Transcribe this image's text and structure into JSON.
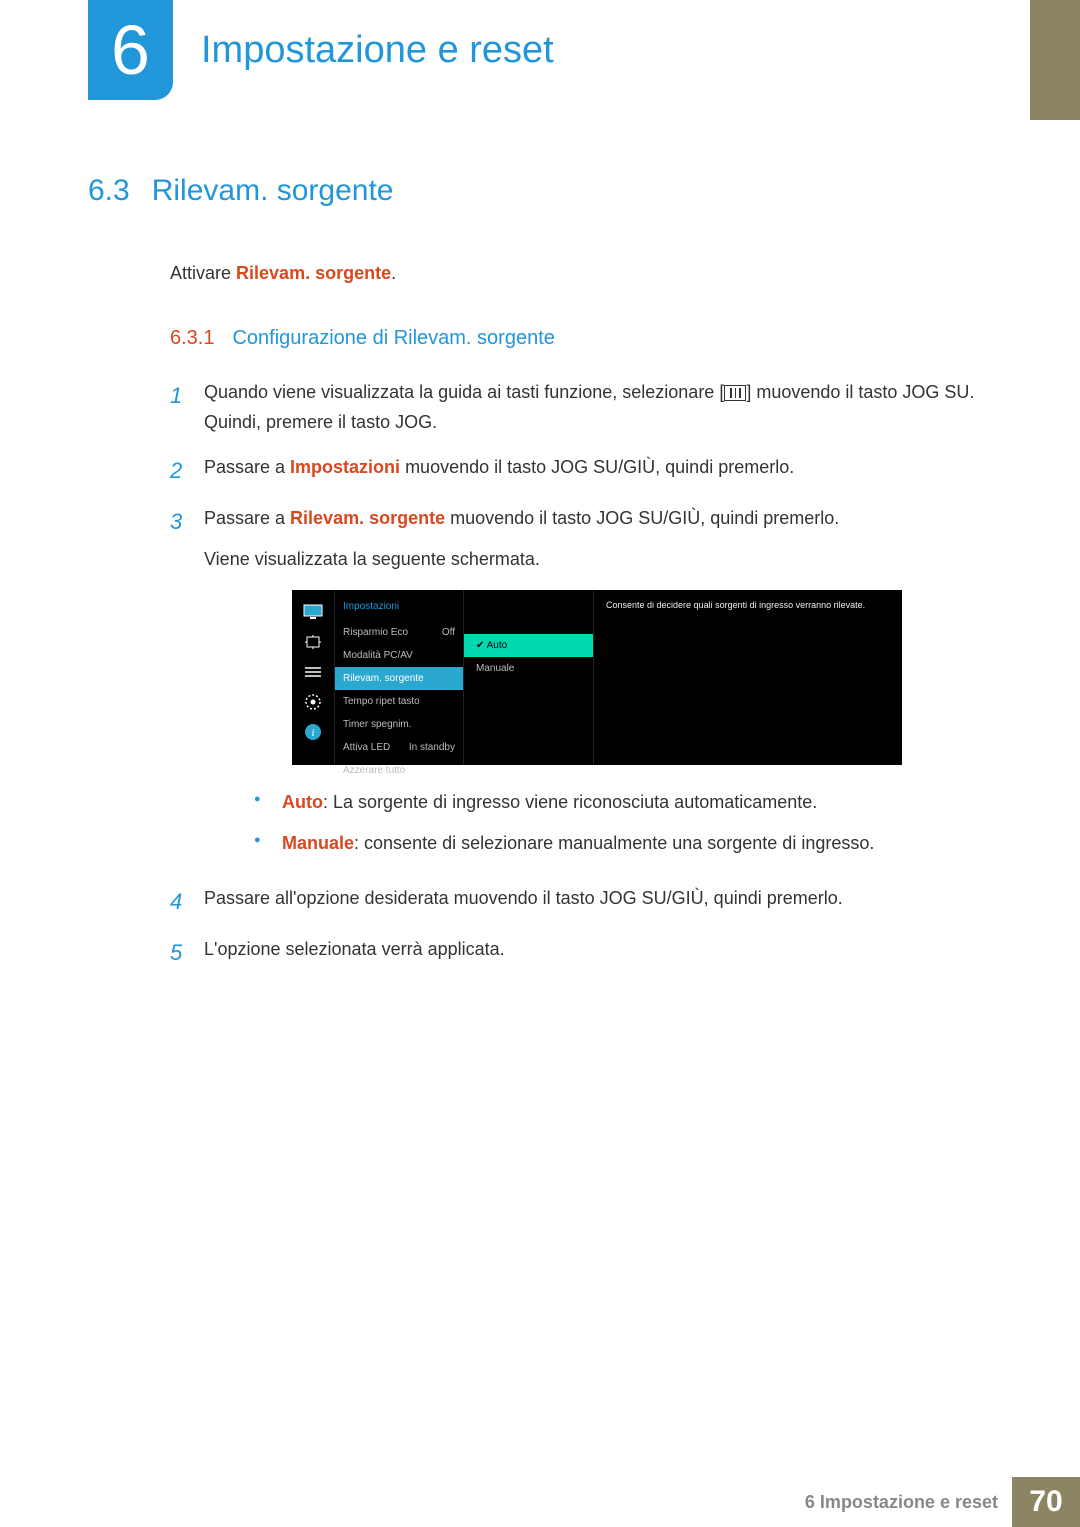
{
  "chapter": {
    "number": "6",
    "title": "Impostazione e reset"
  },
  "section": {
    "number": "6.3",
    "title": "Rilevam. sorgente"
  },
  "intro": {
    "pre": "Attivare ",
    "em": "Rilevam. sorgente",
    "post": "."
  },
  "subsection": {
    "number": "6.3.1",
    "title": "Configurazione di Rilevam. sorgente"
  },
  "steps": {
    "s1": {
      "num": "1",
      "a": "Quando viene visualizzata la guida ai tasti funzione, selezionare [",
      "b": "] muovendo il tasto JOG SU. Quindi, premere il tasto JOG."
    },
    "s2": {
      "num": "2",
      "a": "Passare a ",
      "em": "Impostazioni",
      "b": " muovendo il tasto JOG SU/GIÙ, quindi premerlo."
    },
    "s3": {
      "num": "3",
      "a": "Passare a ",
      "em": "Rilevam. sorgente",
      "b": " muovendo il tasto JOG SU/GIÙ, quindi premerlo.",
      "c": "Viene visualizzata la seguente schermata."
    },
    "s4": {
      "num": "4",
      "text": "Passare all'opzione desiderata muovendo il tasto JOG SU/GIÙ, quindi premerlo."
    },
    "s5": {
      "num": "5",
      "text": "L'opzione selezionata verrà applicata."
    }
  },
  "bullets": {
    "b1": {
      "em": "Auto",
      "text": ": La sorgente di ingresso viene riconosciuta automaticamente."
    },
    "b2": {
      "em": "Manuale",
      "text": ": consente di selezionare manualmente una sorgente di ingresso."
    }
  },
  "osd": {
    "header": "Impostazioni",
    "rows": {
      "r1": {
        "label": "Risparmio Eco",
        "val": "Off"
      },
      "r2": {
        "label": "Modalità PC/AV",
        "val": ""
      },
      "r3": {
        "label": "Rilevam. sorgente",
        "val": ""
      },
      "r4": {
        "label": "Tempo ripet tasto",
        "val": ""
      },
      "r5": {
        "label": "Timer spegnim.",
        "val": ""
      },
      "r6": {
        "label": "Attiva LED",
        "val": "In standby"
      },
      "r7": {
        "label": "Azzerare tutto",
        "val": ""
      }
    },
    "opts": {
      "o1": "Auto",
      "o2": "Manuale"
    },
    "help": "Consente di decidere quali sorgenti di ingresso verranno rilevate."
  },
  "footer": {
    "text": "6 Impostazione e reset",
    "page": "70"
  }
}
